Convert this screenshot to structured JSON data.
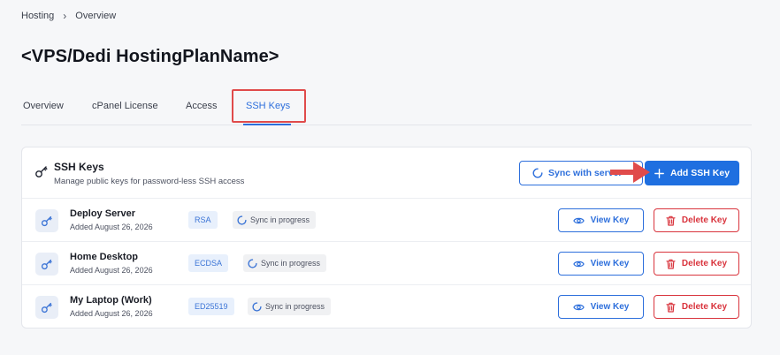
{
  "breadcrumb": {
    "items": [
      "Hosting",
      "Overview"
    ],
    "separator": ">"
  },
  "page": {
    "title": "<VPS/Dedi HostingPlanName>"
  },
  "tabs": [
    {
      "label": "Overview",
      "active": false
    },
    {
      "label": "cPanel License",
      "active": false
    },
    {
      "label": "Access",
      "active": false
    },
    {
      "label": "SSH Keys",
      "active": true
    }
  ],
  "ssh_card": {
    "title": "SSH Keys",
    "subtitle": "Manage public keys for password-less SSH access",
    "sync_button_label": "Sync with server",
    "add_button_label": "Add SSH Key"
  },
  "keys": [
    {
      "name": "Deploy Server",
      "added": "Added August 26, 2026",
      "type": "RSA",
      "status": "Sync in progress",
      "view_label": "View Key",
      "delete_label": "Delete Key"
    },
    {
      "name": "Home Desktop",
      "added": "Added August 26, 2026",
      "type": "ECDSA",
      "status": "Sync in progress",
      "view_label": "View Key",
      "delete_label": "Delete Key"
    },
    {
      "name": "My Laptop (Work)",
      "added": "Added August 26, 2026",
      "type": "ED25519",
      "status": "Sync in progress",
      "view_label": "View Key",
      "delete_label": "Delete Key"
    }
  ],
  "colors": {
    "primary": "#1f6fe0",
    "danger": "#d9343d",
    "annotation": "#e04b4b"
  },
  "icons": {
    "key": "key-icon",
    "eye": "eye-icon",
    "trash": "trash-icon",
    "plus": "plus-icon",
    "spinner": "spinner-icon",
    "chevron": "chevron-right-icon"
  }
}
